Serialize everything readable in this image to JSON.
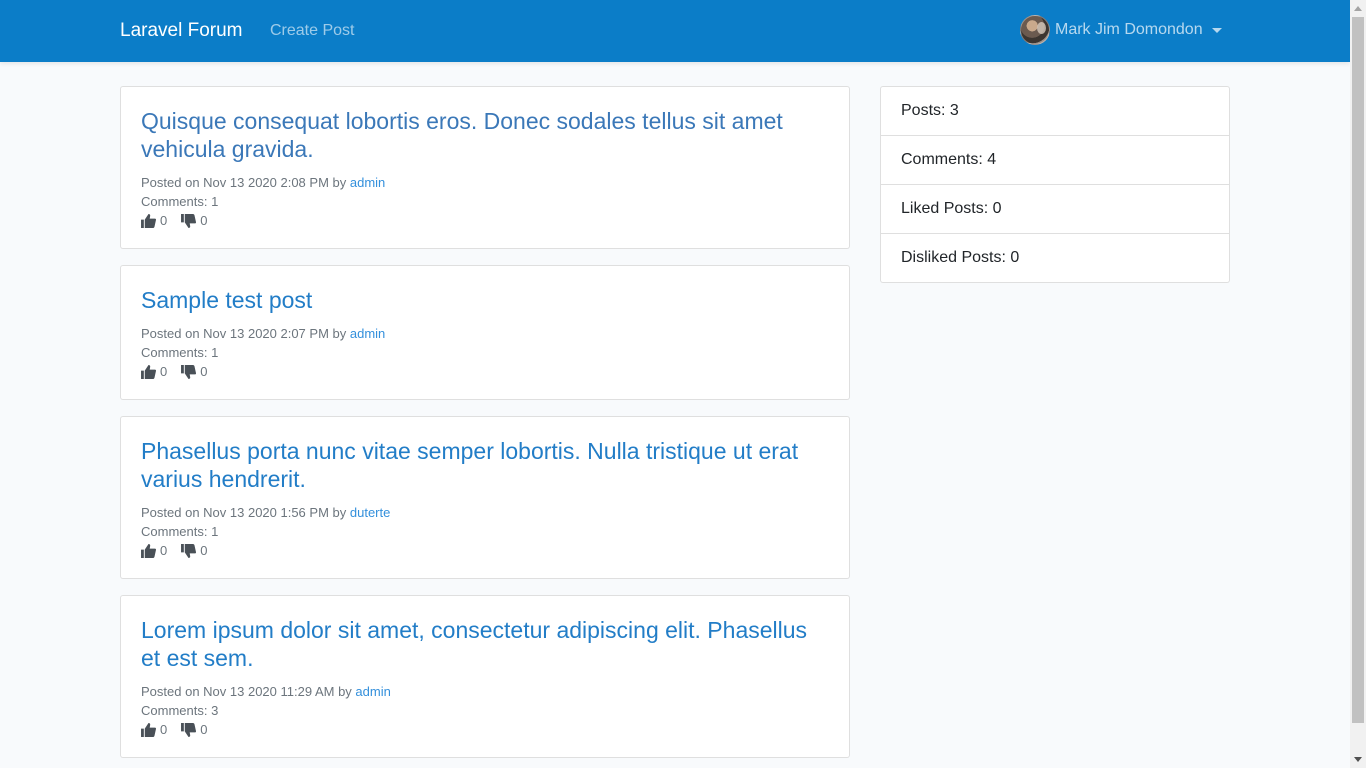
{
  "navbar": {
    "brand": "Laravel Forum",
    "create_post": "Create Post",
    "user_name": "Mark Jim Domondon"
  },
  "posts": [
    {
      "title": "Quisque consequat lobortis eros. Donec sodales tellus sit amet vehicula gravida.",
      "posted_prefix": "Posted on Nov 13 2020 2:08 PM by",
      "author": "admin",
      "comments": "Comments: 1",
      "likes": "0",
      "dislikes": "0"
    },
    {
      "title": "Sample test post",
      "posted_prefix": "Posted on Nov 13 2020 2:07 PM by",
      "author": "admin",
      "comments": "Comments: 1",
      "likes": "0",
      "dislikes": "0"
    },
    {
      "title": "Phasellus porta nunc vitae semper lobortis. Nulla tristique ut erat varius hendrerit.",
      "posted_prefix": "Posted on Nov 13 2020 1:56 PM by",
      "author": "duterte",
      "comments": "Comments: 1",
      "likes": "0",
      "dislikes": "0"
    },
    {
      "title": "Lorem ipsum dolor sit amet, consectetur adipiscing elit. Phasellus et est sem.",
      "posted_prefix": "Posted on Nov 13 2020 11:29 AM by",
      "author": "admin",
      "comments": "Comments: 3",
      "likes": "0",
      "dislikes": "0"
    }
  ],
  "stats": {
    "posts": "Posts: 3",
    "comments": "Comments: 4",
    "liked": "Liked Posts: 0",
    "disliked": "Disliked Posts: 0"
  },
  "icons": {
    "like": "thumbs-up-icon",
    "dislike": "thumbs-down-icon",
    "caret": "caret-down-icon"
  },
  "colors": {
    "navbar": "#0b7dc8",
    "link": "#227dc7",
    "background": "#f8fafc"
  }
}
